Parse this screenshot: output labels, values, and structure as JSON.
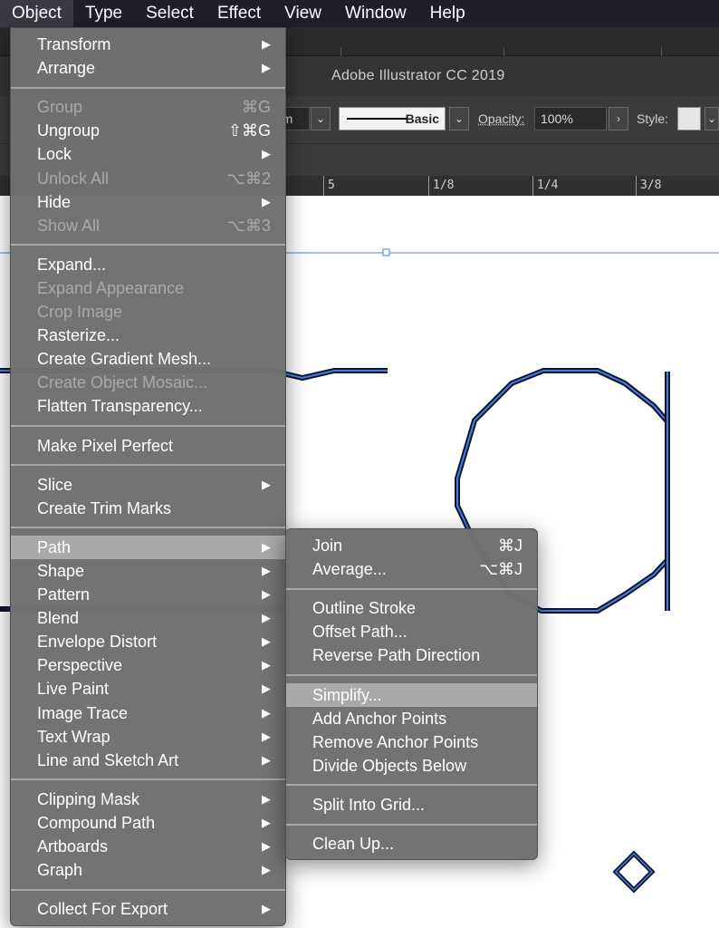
{
  "menubar": [
    "Object",
    "Type",
    "Select",
    "Effect",
    "View",
    "Window",
    "Help"
  ],
  "window_title": "Adobe Illustrator CC 2019",
  "control": {
    "transform_partial": "rm",
    "stroke_style": "Basic",
    "opacity_label": "Opacity:",
    "opacity_value": "100%",
    "style_label": "Style:"
  },
  "ruler_labels": [
    "5",
    "1/8",
    "1/4",
    "3/8"
  ],
  "object_menu": [
    {
      "label": "Transform",
      "submenu": true
    },
    {
      "label": "Arrange",
      "submenu": true
    },
    {
      "sep": true
    },
    {
      "label": "Group",
      "shortcut": "⌘G",
      "disabled": true
    },
    {
      "label": "Ungroup",
      "shortcut": "⇧⌘G"
    },
    {
      "label": "Lock",
      "submenu": true
    },
    {
      "label": "Unlock All",
      "shortcut": "⌥⌘2",
      "disabled": true
    },
    {
      "label": "Hide",
      "submenu": true
    },
    {
      "label": "Show All",
      "shortcut": "⌥⌘3",
      "disabled": true
    },
    {
      "sep": true
    },
    {
      "label": "Expand..."
    },
    {
      "label": "Expand Appearance",
      "disabled": true
    },
    {
      "label": "Crop Image",
      "disabled": true
    },
    {
      "label": "Rasterize..."
    },
    {
      "label": "Create Gradient Mesh..."
    },
    {
      "label": "Create Object Mosaic...",
      "disabled": true
    },
    {
      "label": "Flatten Transparency..."
    },
    {
      "sep": true
    },
    {
      "label": "Make Pixel Perfect"
    },
    {
      "sep": true
    },
    {
      "label": "Slice",
      "submenu": true
    },
    {
      "label": "Create Trim Marks"
    },
    {
      "sep": true
    },
    {
      "label": "Path",
      "submenu": true,
      "highlight": true
    },
    {
      "label": "Shape",
      "submenu": true
    },
    {
      "label": "Pattern",
      "submenu": true
    },
    {
      "label": "Blend",
      "submenu": true
    },
    {
      "label": "Envelope Distort",
      "submenu": true
    },
    {
      "label": "Perspective",
      "submenu": true
    },
    {
      "label": "Live Paint",
      "submenu": true
    },
    {
      "label": "Image Trace",
      "submenu": true
    },
    {
      "label": "Text Wrap",
      "submenu": true
    },
    {
      "label": "Line and Sketch Art",
      "submenu": true
    },
    {
      "sep": true
    },
    {
      "label": "Clipping Mask",
      "submenu": true
    },
    {
      "label": "Compound Path",
      "submenu": true
    },
    {
      "label": "Artboards",
      "submenu": true
    },
    {
      "label": "Graph",
      "submenu": true
    },
    {
      "sep": true
    },
    {
      "label": "Collect For Export",
      "submenu": true
    }
  ],
  "path_submenu": [
    {
      "label": "Join",
      "shortcut": "⌘J"
    },
    {
      "label": "Average...",
      "shortcut": "⌥⌘J"
    },
    {
      "sep": true
    },
    {
      "label": "Outline Stroke"
    },
    {
      "label": "Offset Path..."
    },
    {
      "label": "Reverse Path Direction"
    },
    {
      "sep": true
    },
    {
      "label": "Simplify...",
      "highlight": true
    },
    {
      "label": "Add Anchor Points"
    },
    {
      "label": "Remove Anchor Points"
    },
    {
      "label": "Divide Objects Below"
    },
    {
      "sep": true
    },
    {
      "label": "Split Into Grid..."
    },
    {
      "sep": true
    },
    {
      "label": "Clean Up..."
    }
  ],
  "colors": {
    "menubar_bg": "#1f1f2a",
    "menu_bg": "#707070",
    "menu_highlight": "#a9a9a9",
    "disabled_text": "#a8a8a8",
    "path_stroke_outer": "#0d1430",
    "path_stroke_inner": "#4a7be0",
    "selection_line": "#4a7be0"
  },
  "icons": {
    "submenu_arrow": "▶"
  }
}
